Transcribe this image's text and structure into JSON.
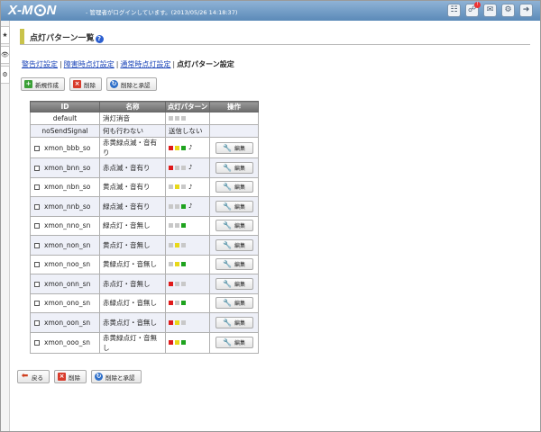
{
  "header": {
    "logo": "X-MON",
    "status": "- 管理者がログインしています。(2013/05/26 14:18:37)",
    "icons": [
      "database-icon",
      "notification-icon",
      "message-icon",
      "settings-icon",
      "logout-icon"
    ],
    "notification_badge": "!"
  },
  "page": {
    "title": "点灯パターン一覧",
    "help": "?"
  },
  "breadcrumb": {
    "items": [
      "警告灯設定",
      "障害時点灯設定",
      "通常時点灯設定"
    ],
    "current": "点灯パターン設定",
    "separator": "|"
  },
  "toolbar_top": {
    "new": "新規作成",
    "delete": "削除",
    "delete_commit": "削除と承認"
  },
  "toolbar_bottom": {
    "back": "戻る",
    "delete": "削除",
    "delete_commit": "削除と承認"
  },
  "table": {
    "headers": [
      "ID",
      "名称",
      "点灯パターン",
      "操作"
    ],
    "edit_label": "編集",
    "rows": [
      {
        "id": "default",
        "name": "消灯消音",
        "lights": [
          "o",
          "o",
          "o"
        ],
        "sound": "",
        "editable": false
      },
      {
        "id": "noSendSignal",
        "name": "何も行わない",
        "lights": [],
        "pattern_text": "送信しない",
        "sound": "",
        "editable": false
      },
      {
        "id": "xmon_bbb_so",
        "name": "赤黄緑点滅・音有り",
        "lights": [
          "r",
          "y",
          "g"
        ],
        "sound": "♪",
        "editable": true
      },
      {
        "id": "xmon_bnn_so",
        "name": "赤点滅・音有り",
        "lights": [
          "r",
          "o",
          "o"
        ],
        "sound": "♪",
        "editable": true
      },
      {
        "id": "xmon_nbn_so",
        "name": "黄点滅・音有り",
        "lights": [
          "o",
          "y",
          "o"
        ],
        "sound": "♪",
        "editable": true
      },
      {
        "id": "xmon_nnb_so",
        "name": "緑点滅・音有り",
        "lights": [
          "o",
          "o",
          "g"
        ],
        "sound": "♪",
        "editable": true
      },
      {
        "id": "xmon_nno_sn",
        "name": "緑点灯・音無し",
        "lights": [
          "o",
          "o",
          "g"
        ],
        "sound": "",
        "editable": true
      },
      {
        "id": "xmon_non_sn",
        "name": "黄点灯・音無し",
        "lights": [
          "o",
          "y",
          "o"
        ],
        "sound": "",
        "editable": true
      },
      {
        "id": "xmon_noo_sn",
        "name": "黄緑点灯・音無し",
        "lights": [
          "o",
          "y",
          "g"
        ],
        "sound": "",
        "editable": true
      },
      {
        "id": "xmon_onn_sn",
        "name": "赤点灯・音無し",
        "lights": [
          "r",
          "o",
          "o"
        ],
        "sound": "",
        "editable": true
      },
      {
        "id": "xmon_ono_sn",
        "name": "赤緑点灯・音無し",
        "lights": [
          "r",
          "o",
          "g"
        ],
        "sound": "",
        "editable": true
      },
      {
        "id": "xmon_oon_sn",
        "name": "赤黄点灯・音無し",
        "lights": [
          "r",
          "y",
          "o"
        ],
        "sound": "",
        "editable": true
      },
      {
        "id": "xmon_ooo_sn",
        "name": "赤黄緑点灯・音無し",
        "lights": [
          "r",
          "y",
          "g"
        ],
        "sound": "",
        "editable": true
      }
    ]
  },
  "colors": {
    "header_top": "#8fb3d6",
    "header_bottom": "#5b8ab8",
    "title_accent": "#c9c34a",
    "link": "#1a44b8",
    "light_red": "#e01a1a",
    "light_yellow": "#e8d81a",
    "light_green": "#1ea31e",
    "light_off": "#c8c8c8"
  }
}
